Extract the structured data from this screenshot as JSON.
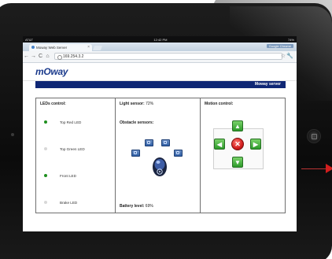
{
  "device": {
    "status": {
      "carrier": "AT&T",
      "time": "12:42 PM",
      "battery": "74%"
    }
  },
  "browser": {
    "tab_title": "Moway Web Server",
    "tab_close": "×",
    "sync_badge": "Google Chrome",
    "url": "169.254.3.2",
    "nav": {
      "back": "←",
      "forward": "→",
      "reload": "C",
      "home": "⌂"
    },
    "star": "☆",
    "wrench": "🔧"
  },
  "page": {
    "logo": "mOway",
    "server_title": "Moway server",
    "leds": {
      "title": "LEDs control:",
      "items": [
        {
          "label": "Top Red LED",
          "on": true,
          "color": "#1f8f1f"
        },
        {
          "label": "Top Green LED",
          "on": false,
          "color": "#d8d8d8"
        },
        {
          "label": "Front LED",
          "on": true,
          "color": "#1f8f1f"
        },
        {
          "label": "Brake LED",
          "on": false,
          "color": "#d8d8d8"
        }
      ]
    },
    "sensors": {
      "light_label": "Light sensor:",
      "light_value": "72%",
      "obstacle_label": "Obstacle sensors:",
      "battery_label": "Battery level:",
      "battery_value": "69%"
    },
    "motion": {
      "title": "Motion control:",
      "up": "▲",
      "down": "▼",
      "left": "◀",
      "right": "▶",
      "stop": "✕"
    }
  },
  "colors": {
    "accent": "#0f2775",
    "arrow_green": "#2c9a2a",
    "stop_red": "#d31e1e"
  }
}
